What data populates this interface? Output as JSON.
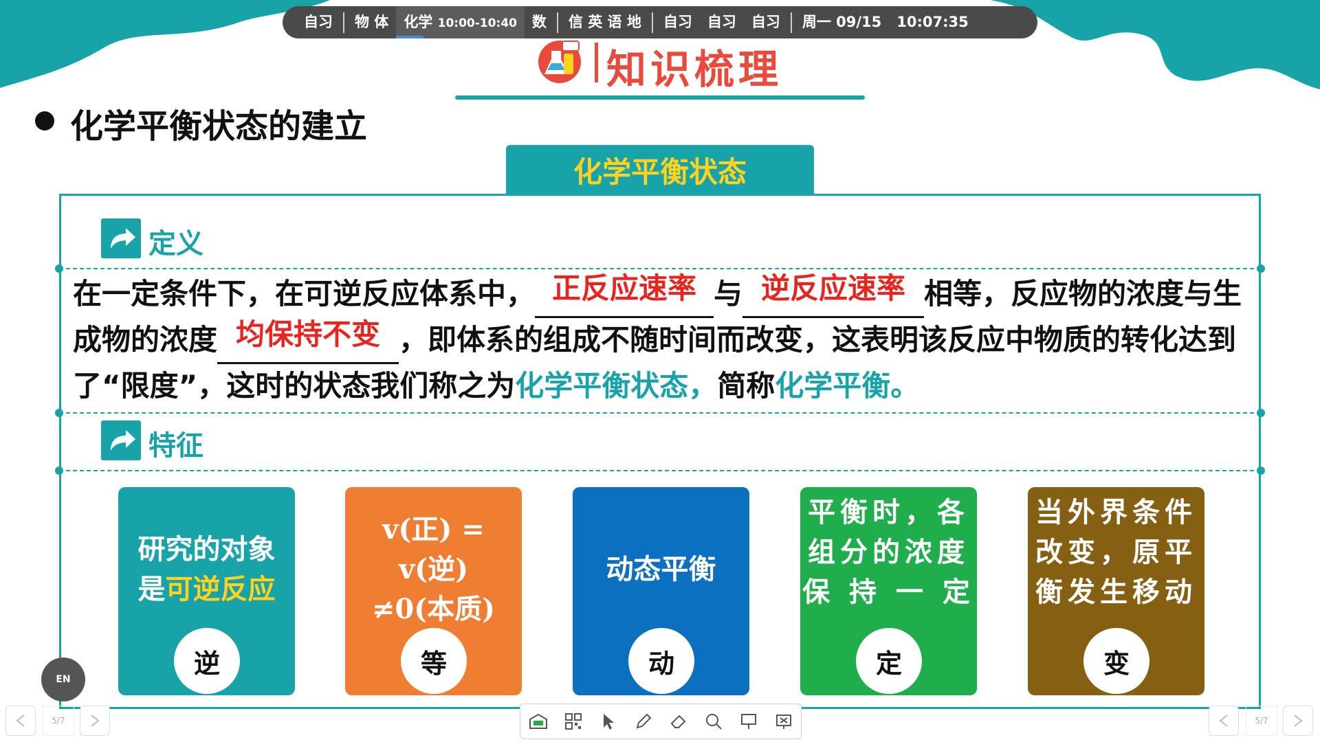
{
  "schedule_bar": {
    "items": [
      {
        "label": "自习",
        "active": false
      },
      {
        "sep": true
      },
      {
        "label": "物  体",
        "active": false
      },
      {
        "label": "化学",
        "time": "10:00-10:40",
        "active": true
      },
      {
        "label": "数",
        "active": false
      },
      {
        "sep": true
      },
      {
        "label": "信  英  语  地",
        "active": false
      },
      {
        "sep": true
      },
      {
        "label": "自习",
        "active": false
      },
      {
        "label": "自习",
        "active": false
      },
      {
        "label": "自习",
        "active": false
      },
      {
        "sep": true
      },
      {
        "label": "周一 09/15",
        "active": false
      },
      {
        "label": "10:07:35",
        "active": false
      }
    ]
  },
  "slide": {
    "title": "知识梳理",
    "heading": "化学平衡状态的建立",
    "tab_title": "化学平衡状态",
    "definition": {
      "label": "定义",
      "text1": "在一定条件下，在可逆反应体系中，",
      "blank1": "正反应速率",
      "text2": "与",
      "blank2": "逆反应速率",
      "text3": "相等，反应物的浓度与生成物的浓度",
      "blank3": "均保持不变",
      "text4": "，即体系的组成不随时间而改变，这表明该反应中物质的转化达到了“限度”，这时的状态我们称之为",
      "highlight1": "化学平衡状态，",
      "text5": "简称",
      "highlight2": "化学平衡。"
    },
    "features": {
      "label": "特征",
      "cards": [
        {
          "line1": "研究的对象",
          "line2a": "是",
          "line2b": "可逆反应",
          "char": "逆",
          "color": "#18a3a8"
        },
        {
          "line1": "v(正) = v(逆)",
          "line2": "≠0(本质)",
          "char": "等",
          "color": "#ef7d32"
        },
        {
          "line1": "动态平衡",
          "char": "动",
          "color": "#0c70c0"
        },
        {
          "line1": "平衡时，各",
          "line2": "组分的浓度",
          "line3": "保 持 一 定",
          "char": "定",
          "color": "#1fae4b"
        },
        {
          "line1": "当外界条件",
          "line2": "改变，原平",
          "line3": "衡发生移动",
          "char": "变",
          "color": "#866012"
        }
      ]
    }
  },
  "bottom": {
    "page_left": "5/7",
    "page_right": "5/7",
    "lang_button": "EN",
    "tools": [
      "classroom-icon",
      "qr-icon",
      "pointer-icon",
      "pen-icon",
      "eraser-icon",
      "search-icon",
      "spotlight-icon",
      "whiteboard-icon"
    ]
  }
}
